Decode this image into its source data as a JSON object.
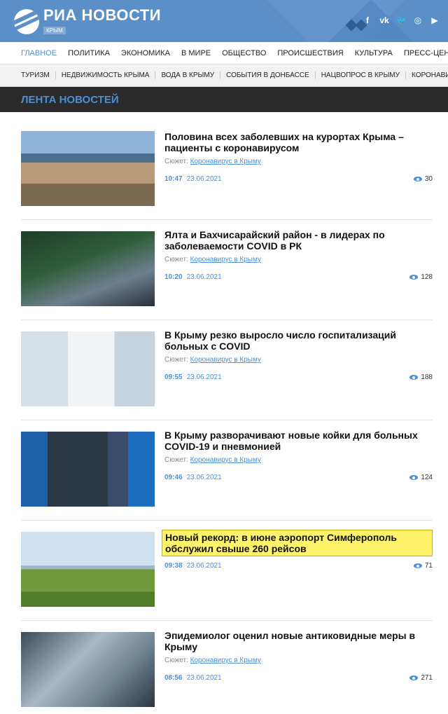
{
  "brand": {
    "title": "РИА НОВОСТИ",
    "subtitle": "КРЫМ"
  },
  "social": [
    "f",
    "vk",
    "tw",
    "ig",
    "yt"
  ],
  "nav_main": [
    {
      "label": "ГЛАВНОЕ",
      "active": true
    },
    {
      "label": "ПОЛИТИКА"
    },
    {
      "label": "ЭКОНОМИКА"
    },
    {
      "label": "В МИРЕ"
    },
    {
      "label": "ОБЩЕСТВО"
    },
    {
      "label": "ПРОИСШЕСТВИЯ"
    },
    {
      "label": "КУЛЬТУРА"
    },
    {
      "label": "ПРЕСС-ЦЕНТР"
    }
  ],
  "nav_sub": [
    {
      "label": "ТУРИЗМ"
    },
    {
      "label": "НЕДВИЖИМОСТЬ КРЫМА"
    },
    {
      "label": "ВОДА В КРЫМУ"
    },
    {
      "label": "СОБЫТИЯ В ДОНБАССЕ"
    },
    {
      "label": "НАЦВОПРОС В КРЫМУ"
    },
    {
      "label": "КОРОНАВИРУС"
    }
  ],
  "section_title": "ЛЕНТА НОВОСТЕЙ",
  "story_prefix": "Сюжет:",
  "news": [
    {
      "title": "Половина всех заболевших на курортах Крыма – пациенты с коронавирусом",
      "story": "Коронавирус в Крыму",
      "time": "10:47",
      "date": "23.06.2021",
      "views": "30"
    },
    {
      "title": "Ялта и Бахчисарайский район - в лидерах по заболеваемости COVID в РК",
      "story": "Коронавирус в Крыму",
      "time": "10:20",
      "date": "23.06.2021",
      "views": "128"
    },
    {
      "title": "В Крыму резко выросло число госпитализаций больных с COVID",
      "story": "Коронавирус в Крыму",
      "time": "09:55",
      "date": "23.06.2021",
      "views": "188"
    },
    {
      "title": "В Крыму разворачивают новые койки для больных COVID-19 и пневмонией",
      "story": "Коронавирус в Крыму",
      "time": "09:46",
      "date": "23.06.2021",
      "views": "124"
    },
    {
      "title": "Новый рекорд: в июне аэропорт Симферополь обслужил свыше 260 рейсов",
      "time": "09:38",
      "date": "23.06.2021",
      "views": "71",
      "highlighted": true
    },
    {
      "title": "Эпидемиолог оценил новые антиковидные меры в Крыму",
      "story": "Коронавирус в Крыму",
      "time": "08:56",
      "date": "23.06.2021",
      "views": "271"
    }
  ]
}
